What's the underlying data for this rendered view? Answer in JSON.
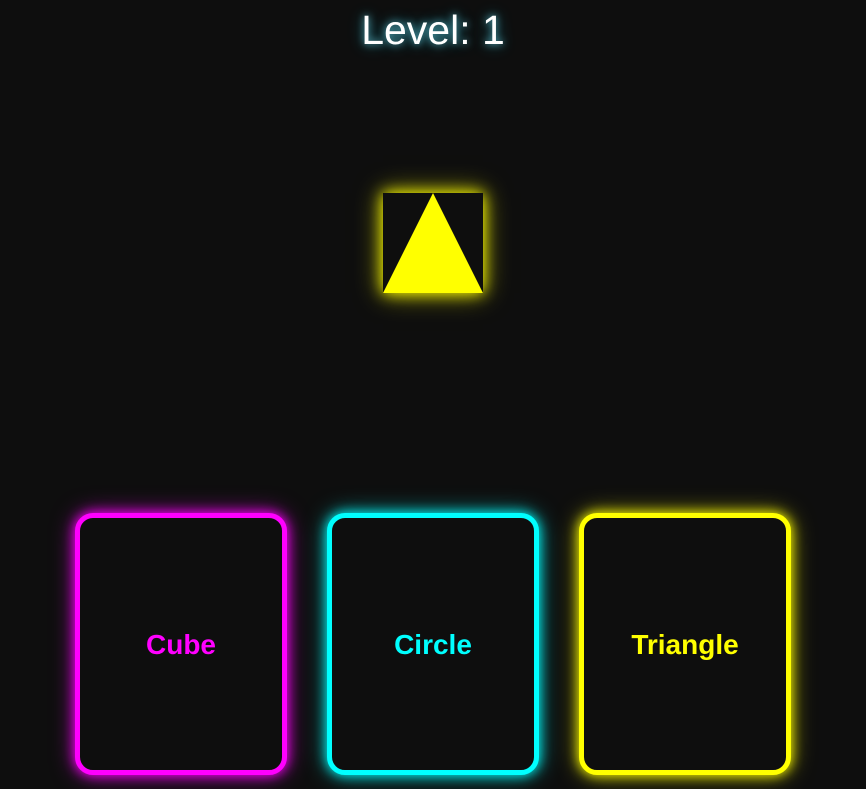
{
  "header": {
    "level_text": "Level: 1"
  },
  "target_shape": {
    "icon": "triangle-icon",
    "color": "#ffff00"
  },
  "choices": [
    {
      "label": "Cube",
      "color": "#ff00ff"
    },
    {
      "label": "Circle",
      "color": "#00ffff"
    },
    {
      "label": "Triangle",
      "color": "#ffff00"
    }
  ]
}
